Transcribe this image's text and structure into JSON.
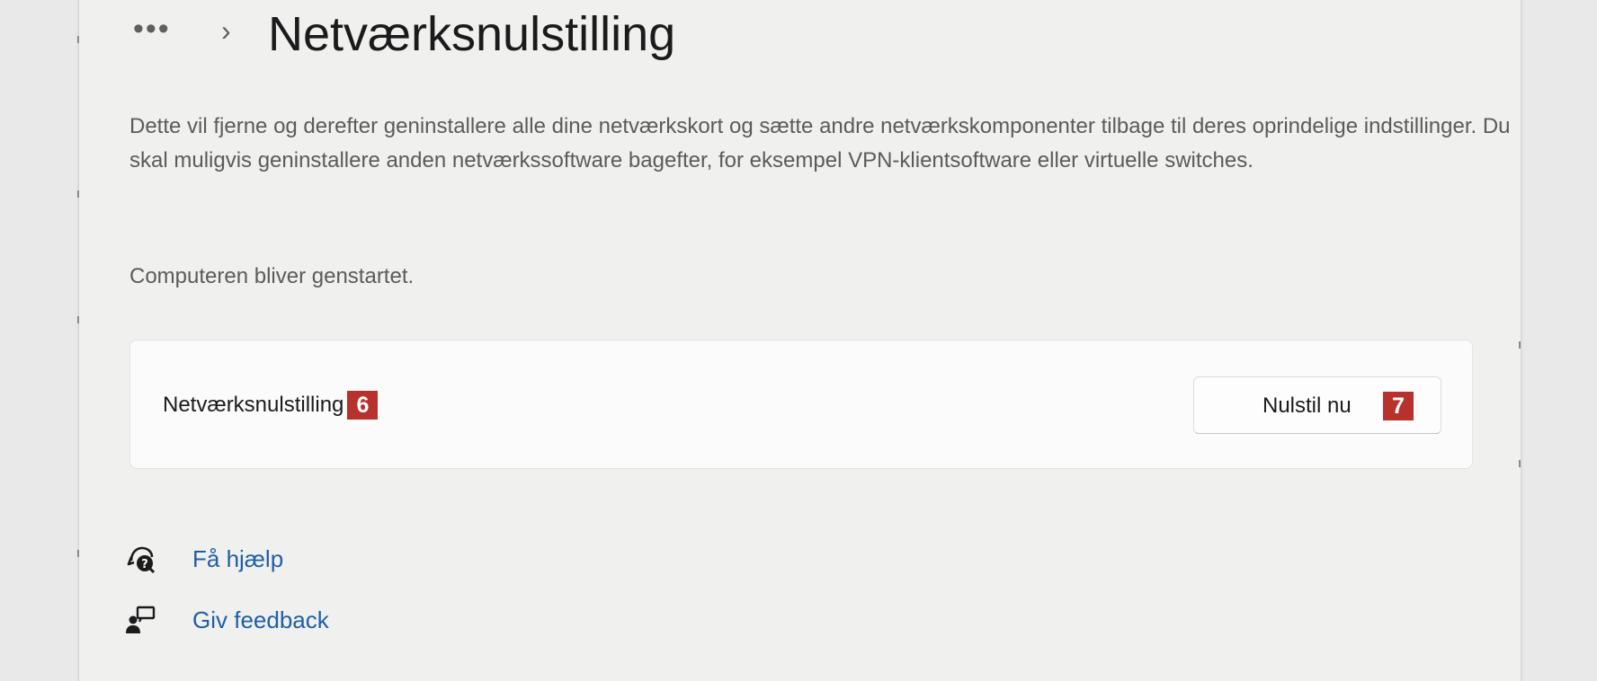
{
  "breadcrumb": {
    "ellipsis": "•••",
    "separator": "›",
    "title": "Netværksnulstilling"
  },
  "description": "Dette vil fjerne og derefter geninstallere alle dine netværkskort og sætte andre netværkskomponenter tilbage til deres oprindelige indstillinger. Du skal muligvis geninstallere anden netværkssoftware bagefter, for eksempel VPN-klientsoftware eller virtuelle switches.",
  "restart_note": "Computeren bliver genstartet.",
  "reset_card": {
    "label": "Netværksnulstilling",
    "label_badge": "6",
    "button_label": "Nulstil nu",
    "button_badge": "7"
  },
  "links": [
    {
      "label": "Få hjælp",
      "icon": "help-chat-icon"
    },
    {
      "label": "Giv feedback",
      "icon": "feedback-icon"
    }
  ],
  "colors": {
    "badge": "#b8322d",
    "link": "#1f5fa6",
    "background": "#f0f0ef"
  }
}
